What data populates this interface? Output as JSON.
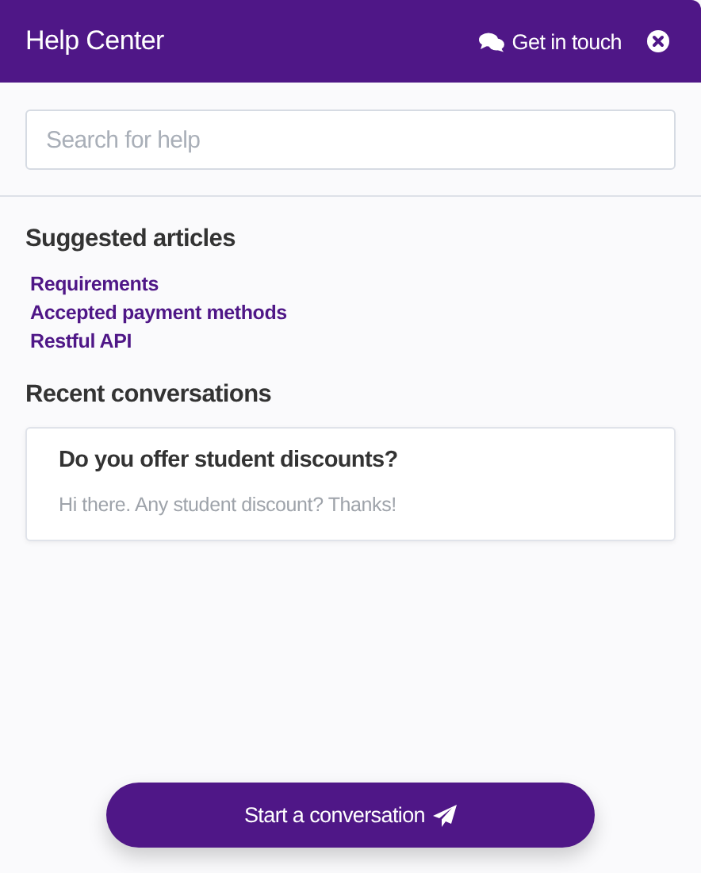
{
  "header": {
    "title": "Help Center",
    "contact_link": "Get in touch"
  },
  "search": {
    "placeholder": "Search for help"
  },
  "suggested": {
    "heading": "Suggested articles",
    "articles": [
      "Requirements",
      "Accepted payment methods",
      "Restful API"
    ]
  },
  "recent": {
    "heading": "Recent conversations",
    "conversations": [
      {
        "title": "Do you offer student discounts?",
        "preview": "Hi there. Any student discount? Thanks!"
      }
    ]
  },
  "start_button": "Start a conversation"
}
